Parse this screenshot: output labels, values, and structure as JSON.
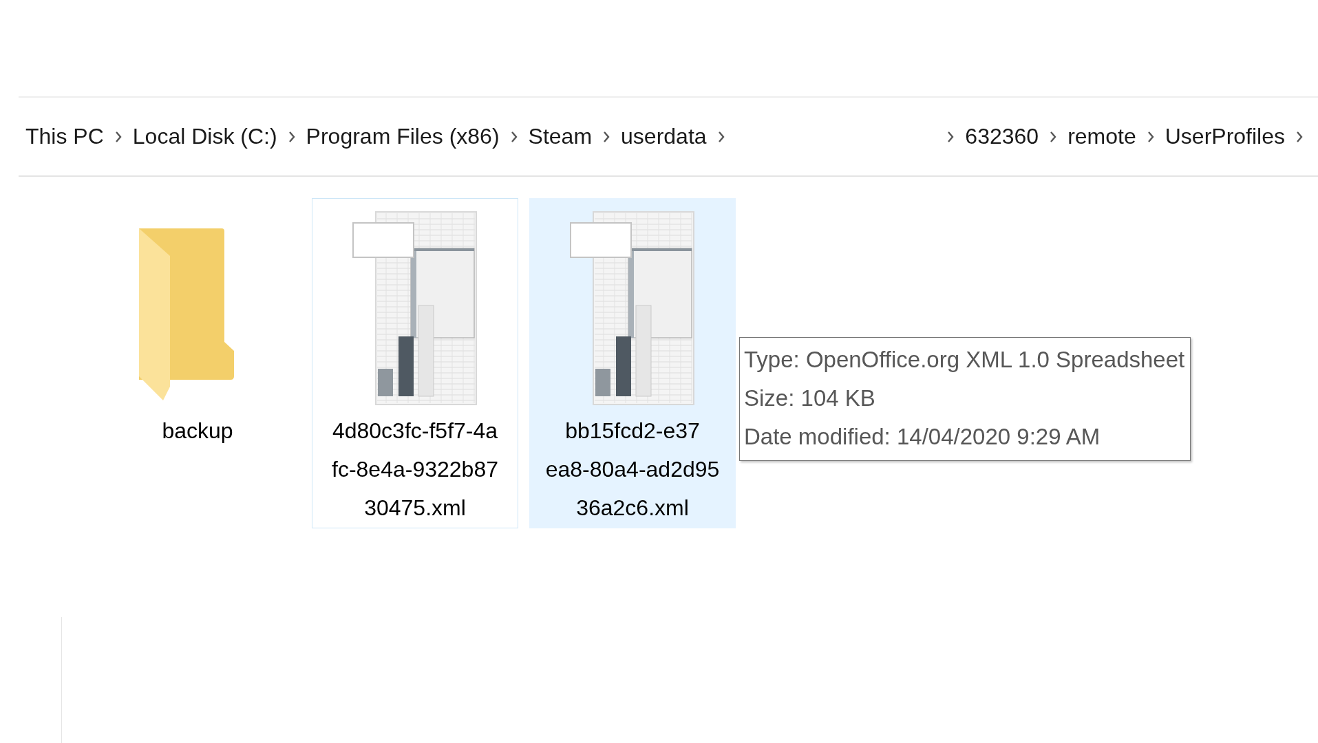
{
  "breadcrumb": {
    "left": [
      {
        "label": "This PC"
      },
      {
        "label": "Local Disk (C:)"
      },
      {
        "label": "Program Files (x86)"
      },
      {
        "label": "Steam"
      },
      {
        "label": "userdata"
      }
    ],
    "right": [
      {
        "label": "632360"
      },
      {
        "label": "remote"
      },
      {
        "label": "UserProfiles"
      }
    ]
  },
  "items": [
    {
      "kind": "folder",
      "label_lines": [
        "backup"
      ],
      "selected": false,
      "focused": false
    },
    {
      "kind": "spreadsheet",
      "label_lines": [
        "4d80c3fc-f5f7-4a",
        "fc-8e4a-9322b87",
        "30475.xml"
      ],
      "selected": false,
      "focused": true
    },
    {
      "kind": "spreadsheet",
      "label_lines": [
        "bb15fcd2-e37",
        "ea8-80a4-ad2d95",
        "36a2c6.xml"
      ],
      "selected": true,
      "focused": false
    }
  ],
  "tooltip": {
    "lines": [
      "Type: OpenOffice.org XML 1.0 Spreadsheet",
      "Size: 104 KB",
      "Date modified: 14/04/2020 9:29 AM"
    ]
  }
}
